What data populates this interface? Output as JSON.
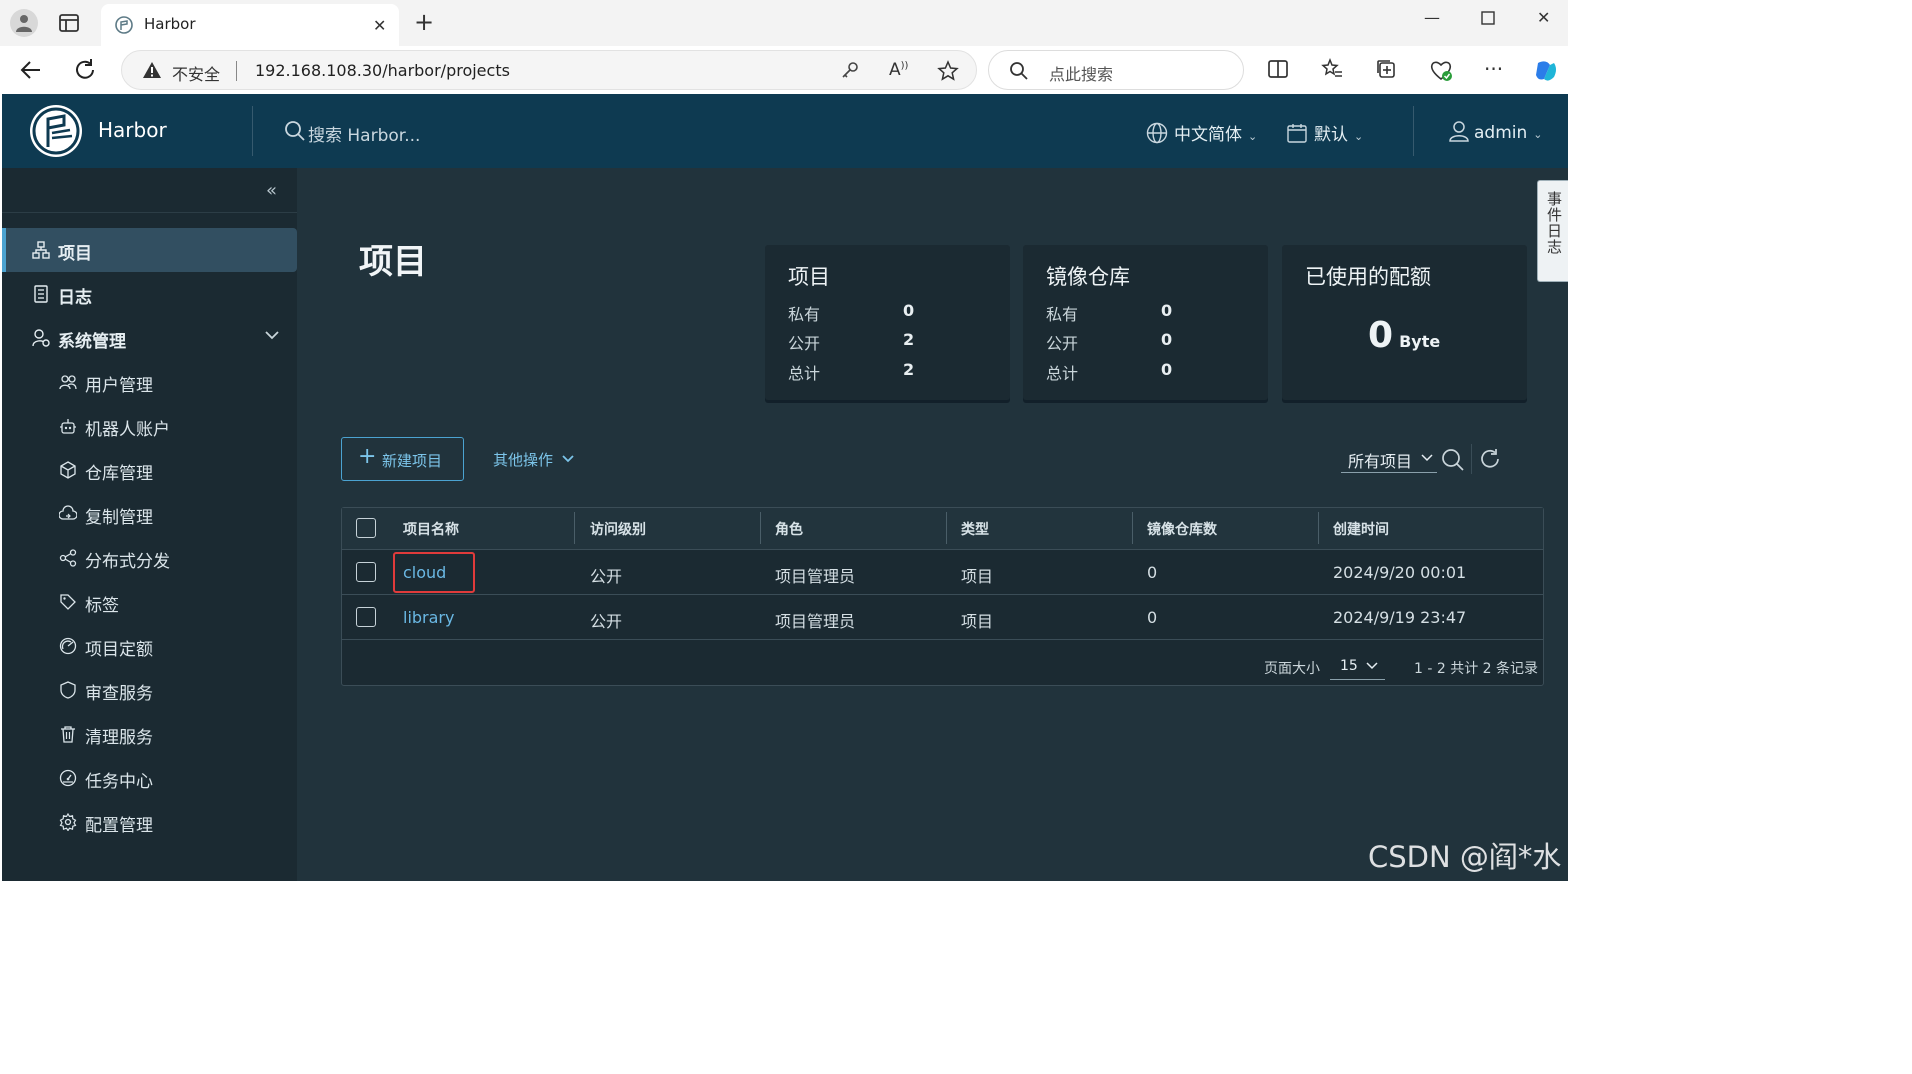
{
  "browser": {
    "tab_title": "Harbor",
    "insecure_label": "不安全",
    "url": "192.168.108.30/harbor/projects",
    "search_placeholder": "点此搜索"
  },
  "header": {
    "brand": "Harbor",
    "search_placeholder": "搜索 Harbor...",
    "language": "中文简体",
    "date_format": "默认",
    "user": "admin"
  },
  "sidebar": {
    "items": [
      {
        "label": "项目",
        "icon": "projects-icon",
        "active": true
      },
      {
        "label": "日志",
        "icon": "logs-icon"
      },
      {
        "label": "系统管理",
        "icon": "admin-icon",
        "expanded": true
      }
    ],
    "sub_items": [
      {
        "label": "用户管理",
        "icon": "users-icon"
      },
      {
        "label": "机器人账户",
        "icon": "robot-icon"
      },
      {
        "label": "仓库管理",
        "icon": "registry-icon"
      },
      {
        "label": "复制管理",
        "icon": "replication-icon"
      },
      {
        "label": "分布式分发",
        "icon": "share-icon"
      },
      {
        "label": "标签",
        "icon": "tag-icon"
      },
      {
        "label": "项目定额",
        "icon": "quota-icon"
      },
      {
        "label": "审查服务",
        "icon": "shield-icon"
      },
      {
        "label": "清理服务",
        "icon": "trash-icon"
      },
      {
        "label": "任务中心",
        "icon": "dashboard-icon"
      },
      {
        "label": "配置管理",
        "icon": "gear-icon"
      }
    ]
  },
  "page": {
    "title": "项目",
    "event_tab": "事件日志",
    "watermark": "CSDN @阎*水"
  },
  "cards": {
    "projects": {
      "title": "项目",
      "rows": [
        {
          "label": "私有",
          "value": "0"
        },
        {
          "label": "公开",
          "value": "2"
        },
        {
          "label": "总计",
          "value": "2"
        }
      ]
    },
    "repos": {
      "title": "镜像仓库",
      "rows": [
        {
          "label": "私有",
          "value": "0"
        },
        {
          "label": "公开",
          "value": "0"
        },
        {
          "label": "总计",
          "value": "0"
        }
      ]
    },
    "quota": {
      "title": "已使用的配额",
      "value": "0",
      "unit": "Byte"
    }
  },
  "toolbar": {
    "new_project": "新建项目",
    "more_actions": "其他操作",
    "filter": "所有项目"
  },
  "table": {
    "columns": [
      "项目名称",
      "访问级别",
      "角色",
      "类型",
      "镜像仓库数",
      "创建时间"
    ],
    "rows": [
      {
        "name": "cloud",
        "access": "公开",
        "role": "项目管理员",
        "type": "项目",
        "repos": "0",
        "created": "2024/9/20 00:01"
      },
      {
        "name": "library",
        "access": "公开",
        "role": "项目管理员",
        "type": "项目",
        "repos": "0",
        "created": "2024/9/19 23:47"
      }
    ],
    "page_size_label": "页面大小",
    "page_size": "15",
    "count": "1 - 2 共计 2 条记录"
  },
  "colors": {
    "header": "#0e3a51",
    "sidebar": "#1b2a32",
    "main": "#21333c",
    "accent": "#4ba3d1",
    "link": "#6ab8e4",
    "highlight": "#e03b3b"
  }
}
